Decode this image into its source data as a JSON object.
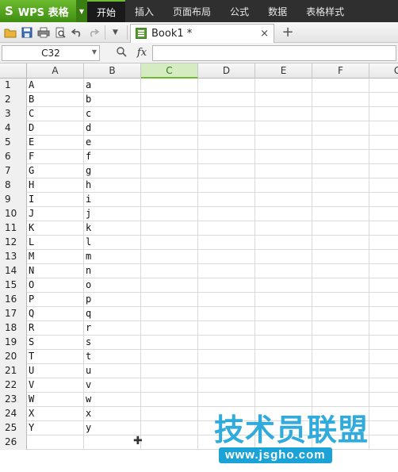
{
  "titlebar": {
    "app_logo": "S",
    "app_name": "WPS 表格",
    "menu": [
      "开始",
      "插入",
      "页面布局",
      "公式",
      "数据",
      "表格样式"
    ]
  },
  "toolbar": {
    "tab_title": "Book1 *",
    "close_glyph": "×",
    "new_tab_glyph": "+"
  },
  "formula": {
    "namebox": "C32",
    "fx": "fx",
    "value": ""
  },
  "grid": {
    "columns": [
      "A",
      "B",
      "C",
      "D",
      "E",
      "F",
      "G"
    ],
    "selected_column": "C",
    "rows": [
      {
        "n": "1",
        "a": "A",
        "b": "a"
      },
      {
        "n": "2",
        "a": "B",
        "b": "b"
      },
      {
        "n": "3",
        "a": "C",
        "b": "c"
      },
      {
        "n": "4",
        "a": "D",
        "b": "d"
      },
      {
        "n": "5",
        "a": "E",
        "b": "e"
      },
      {
        "n": "6",
        "a": "F",
        "b": "f"
      },
      {
        "n": "7",
        "a": "G",
        "b": "g"
      },
      {
        "n": "8",
        "a": "H",
        "b": "h"
      },
      {
        "n": "9",
        "a": "I",
        "b": "i"
      },
      {
        "n": "10",
        "a": "J",
        "b": "j"
      },
      {
        "n": "11",
        "a": "K",
        "b": "k"
      },
      {
        "n": "12",
        "a": "L",
        "b": "l"
      },
      {
        "n": "13",
        "a": "M",
        "b": "m"
      },
      {
        "n": "14",
        "a": "N",
        "b": "n"
      },
      {
        "n": "15",
        "a": "O",
        "b": "o"
      },
      {
        "n": "16",
        "a": "P",
        "b": "p"
      },
      {
        "n": "17",
        "a": "Q",
        "b": "q"
      },
      {
        "n": "18",
        "a": "R",
        "b": "r"
      },
      {
        "n": "19",
        "a": "S",
        "b": "s"
      },
      {
        "n": "20",
        "a": "T",
        "b": "t"
      },
      {
        "n": "21",
        "a": "U",
        "b": "u"
      },
      {
        "n": "22",
        "a": "V",
        "b": "v"
      },
      {
        "n": "23",
        "a": "W",
        "b": "w"
      },
      {
        "n": "24",
        "a": "X",
        "b": "x"
      },
      {
        "n": "25",
        "a": "Y",
        "b": "y"
      },
      {
        "n": "26",
        "a": "",
        "b": ""
      }
    ]
  },
  "watermark": {
    "title": "技术员联盟",
    "url": "www.jsgho.com"
  }
}
